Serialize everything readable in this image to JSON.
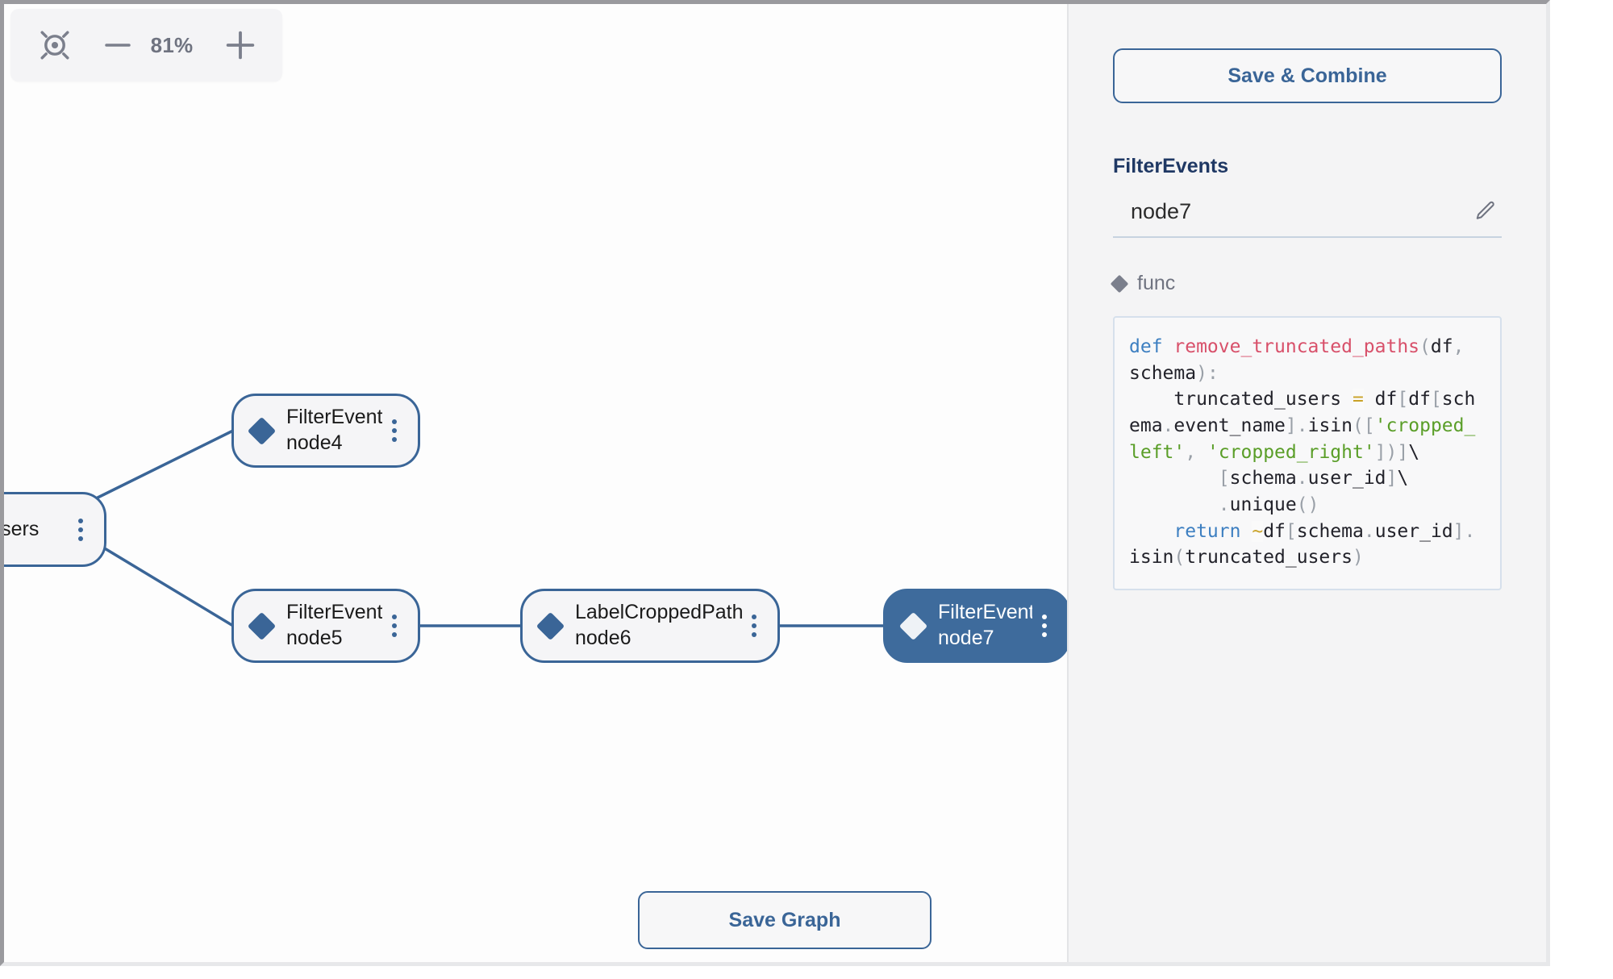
{
  "zoom_toolbar": {
    "fit_view_icon": "fit-view-target-icon",
    "zoom_out_icon": "minus-icon",
    "zoom_in_icon": "plus-icon",
    "zoom_level": "81%"
  },
  "graph": {
    "save_graph_label": "Save Graph",
    "nodes": [
      {
        "type": "",
        "id": "",
        "clipped_label": "wUsers",
        "selected": false,
        "menu_icon": "kebab-menu-icon"
      },
      {
        "type": "FilterEvents",
        "id": "node4",
        "selected": false,
        "menu_icon": "kebab-menu-icon"
      },
      {
        "type": "FilterEvents",
        "id": "node5",
        "selected": false,
        "menu_icon": "kebab-menu-icon"
      },
      {
        "type": "LabelCroppedPaths",
        "id": "node6",
        "selected": false,
        "menu_icon": "kebab-menu-icon"
      },
      {
        "type": "FilterEvents",
        "id": "node7",
        "selected": true,
        "menu_icon": "kebab-menu-icon"
      }
    ],
    "edge_color": "#3a6597",
    "node_border_color": "#3a6597",
    "node_fill_color": "#f5f5f7",
    "selected_node_fill_color": "#3e6b9c"
  },
  "panel": {
    "save_combine_label": "Save & Combine",
    "node_type_title": "FilterEvents",
    "node_name_value": "node7",
    "edit_icon": "pencil-icon",
    "func_section_label": "func",
    "func_section_icon": "diamond-icon",
    "code": {
      "language": "python",
      "tokens": [
        {
          "t": "def ",
          "c": "kw"
        },
        {
          "t": "remove_truncated_paths",
          "c": "fn"
        },
        {
          "t": "(",
          "c": "punc"
        },
        {
          "t": "df",
          "c": "plain"
        },
        {
          "t": ",",
          "c": "punc"
        },
        {
          "t": " schema",
          "c": "plain"
        },
        {
          "t": ")",
          "c": "punc"
        },
        {
          "t": ":",
          "c": "punc"
        },
        {
          "t": "\n    truncated_users ",
          "c": "plain"
        },
        {
          "t": "=",
          "c": "op"
        },
        {
          "t": " df",
          "c": "plain"
        },
        {
          "t": "[",
          "c": "punc"
        },
        {
          "t": "df",
          "c": "plain"
        },
        {
          "t": "[",
          "c": "punc"
        },
        {
          "t": "schema",
          "c": "plain"
        },
        {
          "t": ".",
          "c": "punc"
        },
        {
          "t": "event_name",
          "c": "plain"
        },
        {
          "t": "]",
          "c": "punc"
        },
        {
          "t": ".",
          "c": "punc"
        },
        {
          "t": "isin",
          "c": "plain"
        },
        {
          "t": "(",
          "c": "punc"
        },
        {
          "t": "[",
          "c": "punc"
        },
        {
          "t": "'cropped_left'",
          "c": "str"
        },
        {
          "t": ",",
          "c": "punc"
        },
        {
          "t": " ",
          "c": "plain"
        },
        {
          "t": "'cropped_right'",
          "c": "str"
        },
        {
          "t": "])]",
          "c": "punc"
        },
        {
          "t": "\\",
          "c": "plain"
        },
        {
          "t": "\n        ",
          "c": "plain"
        },
        {
          "t": "[",
          "c": "punc"
        },
        {
          "t": "schema",
          "c": "plain"
        },
        {
          "t": ".",
          "c": "punc"
        },
        {
          "t": "user_id",
          "c": "plain"
        },
        {
          "t": "]",
          "c": "punc"
        },
        {
          "t": "\\",
          "c": "plain"
        },
        {
          "t": "\n        ",
          "c": "plain"
        },
        {
          "t": ".",
          "c": "punc"
        },
        {
          "t": "unique",
          "c": "plain"
        },
        {
          "t": "()",
          "c": "punc"
        },
        {
          "t": "\n    ",
          "c": "plain"
        },
        {
          "t": "return",
          "c": "kw"
        },
        {
          "t": " ",
          "c": "plain"
        },
        {
          "t": "~",
          "c": "op"
        },
        {
          "t": "df",
          "c": "plain"
        },
        {
          "t": "[",
          "c": "punc"
        },
        {
          "t": "schema",
          "c": "plain"
        },
        {
          "t": ".",
          "c": "punc"
        },
        {
          "t": "user_id",
          "c": "plain"
        },
        {
          "t": "]",
          "c": "punc"
        },
        {
          "t": ".",
          "c": "punc"
        },
        {
          "t": "isin",
          "c": "plain"
        },
        {
          "t": "(",
          "c": "punc"
        },
        {
          "t": "truncated_users",
          "c": "plain"
        },
        {
          "t": ")",
          "c": "punc"
        }
      ]
    }
  },
  "colors": {
    "accent_blue": "#3a6597",
    "selected_node": "#3e6b9c",
    "panel_bg": "#f4f4f5",
    "title_navy": "#1f3864",
    "muted_gray": "#6f7380"
  }
}
